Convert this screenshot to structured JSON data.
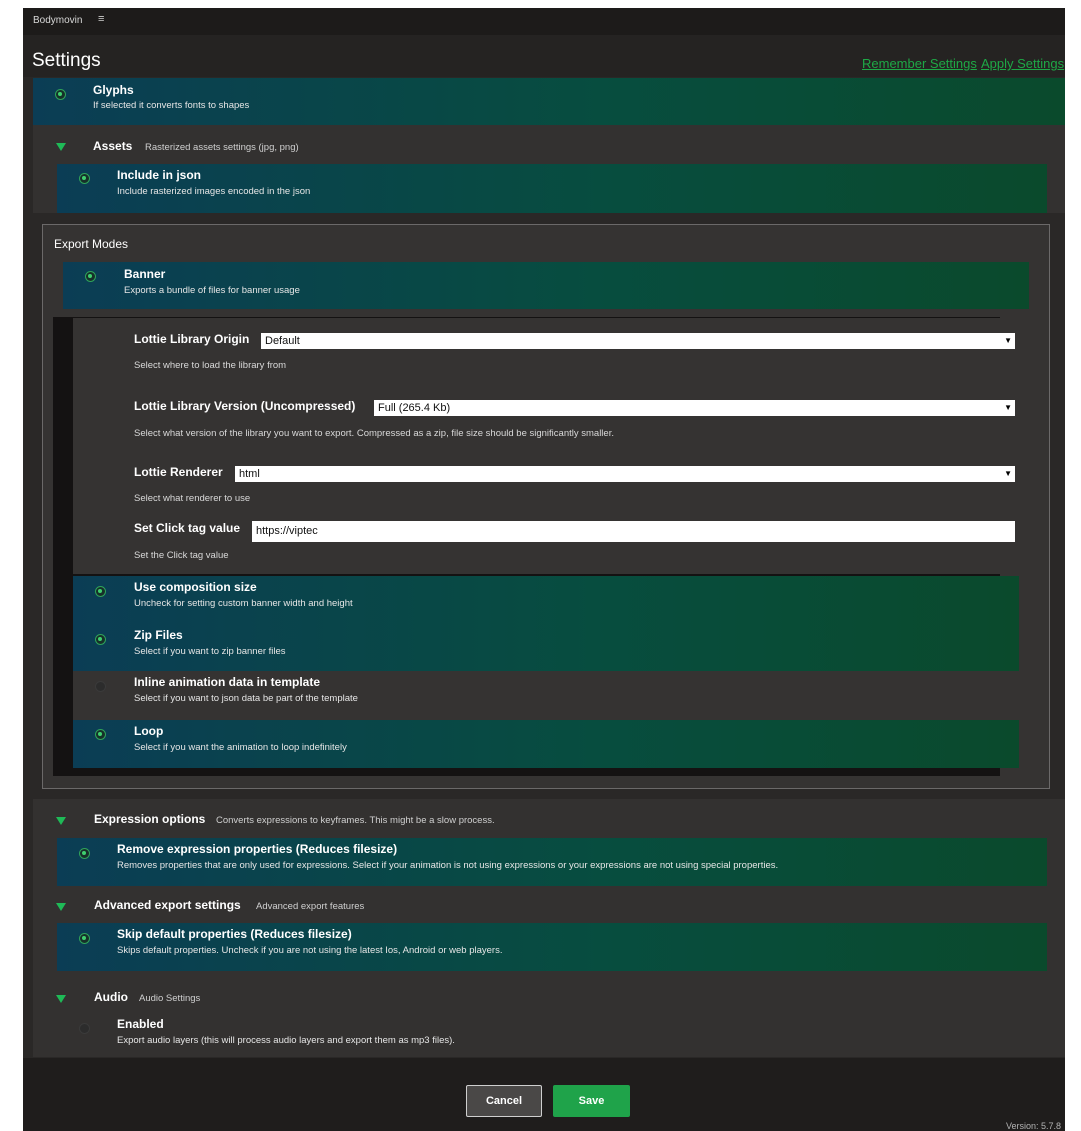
{
  "app": {
    "name": "Bodymovin",
    "menu_icon": "hamburger-icon"
  },
  "header": {
    "title": "Settings",
    "remember_label": "Remember Settings",
    "apply_label": "Apply Settings"
  },
  "glyphs": {
    "title": "Glyphs",
    "desc": "If selected it converts fonts to shapes",
    "checked": true
  },
  "assets": {
    "title": "Assets",
    "desc": "Rasterized assets settings (jpg, png)",
    "include_json": {
      "title": "Include in json",
      "desc": "Include rasterized images encoded in the json",
      "checked": true
    }
  },
  "export_modes": {
    "title": "Export Modes",
    "banner": {
      "title": "Banner",
      "desc": "Exports a bundle of files for banner usage",
      "checked": true
    },
    "fields": {
      "origin": {
        "label": "Lottie Library Origin",
        "value": "Default",
        "help": "Select where to load the library from"
      },
      "version": {
        "label": "Lottie Library Version (Uncompressed)",
        "value": "Full (265.4 Kb)",
        "help": "Select what version of the library you want to export. Compressed as a zip, file size should be significantly smaller."
      },
      "renderer": {
        "label": "Lottie Renderer",
        "value": "html",
        "help": "Select what renderer to use"
      },
      "clicktag": {
        "label": "Set Click tag value",
        "value": "https://viptec",
        "help": "Set the Click tag value"
      }
    },
    "options": [
      {
        "title": "Use composition size",
        "desc": "Uncheck for setting custom banner width and height",
        "checked": true
      },
      {
        "title": "Zip Files",
        "desc": "Select if you want to zip banner files",
        "checked": true
      },
      {
        "title": "Inline animation data in template",
        "desc": "Select if you want to json data be part of the template",
        "checked": false
      },
      {
        "title": "Loop",
        "desc": "Select if you want the animation to loop indefinitely",
        "checked": true
      }
    ]
  },
  "expression": {
    "title": "Expression options",
    "desc": "Converts expressions to keyframes. This might be a slow process.",
    "remove": {
      "title": "Remove expression properties (Reduces filesize)",
      "desc": "Removes properties that are only used for expressions. Select if your animation is not using expressions or your expressions are not using special properties.",
      "checked": true
    }
  },
  "advanced": {
    "title": "Advanced export settings",
    "desc": "Advanced export features",
    "skip": {
      "title": "Skip default properties (Reduces filesize)",
      "desc": "Skips default properties. Uncheck if you are not using the latest Ios, Android or web players.",
      "checked": true
    }
  },
  "audio": {
    "title": "Audio",
    "desc": "Audio Settings",
    "enabled": {
      "title": "Enabled",
      "desc": "Export audio layers (this will process audio layers and export them as mp3 files).",
      "checked": false
    }
  },
  "footer": {
    "cancel_label": "Cancel",
    "save_label": "Save",
    "version": "Version: 5.7.8"
  },
  "colors": {
    "accent": "#1fa34a",
    "row_teal": "#0b3d55",
    "row_green": "#0a4a2c",
    "background": "#2a2827"
  }
}
